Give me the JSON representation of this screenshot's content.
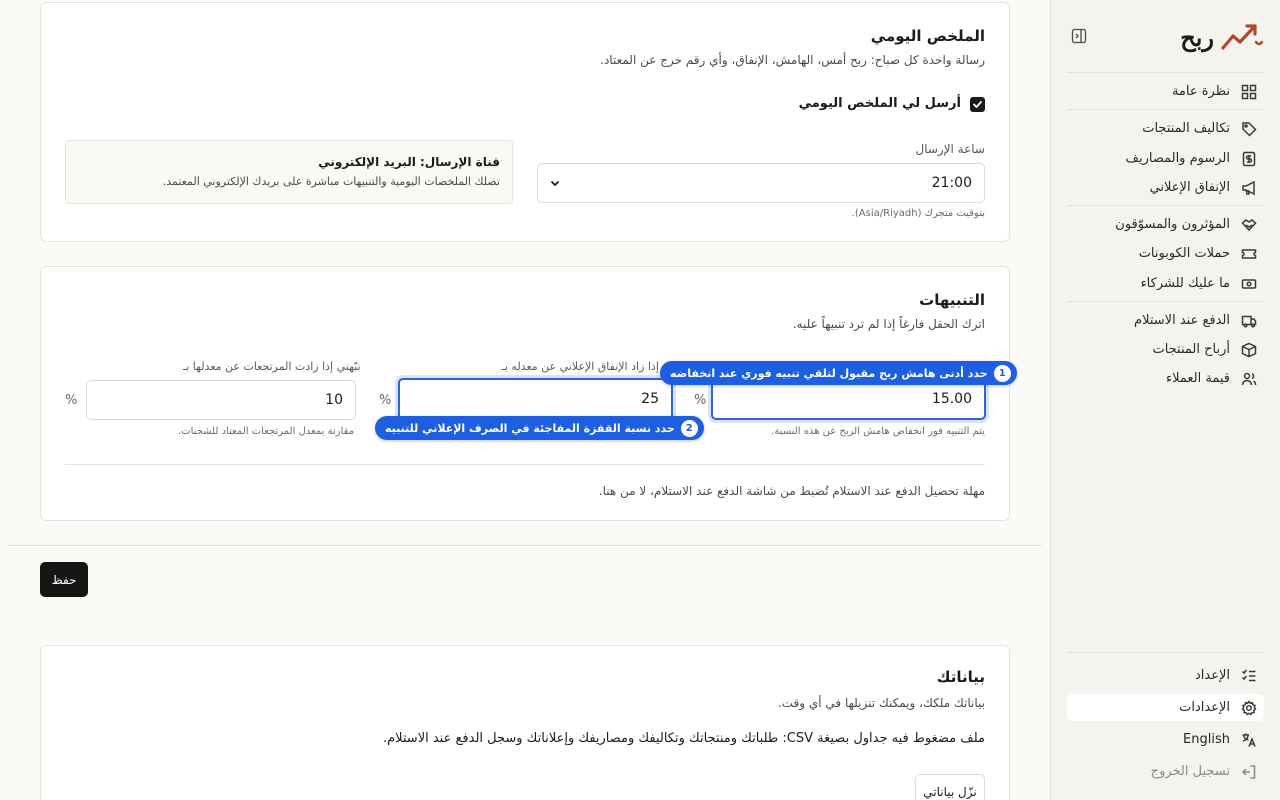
{
  "sidebar": {
    "brand": "ربح",
    "items": [
      {
        "label": "نظرة عامة",
        "icon": "grid-icon"
      },
      {
        "label": "تكاليف المنتجات",
        "icon": "tag-icon"
      },
      {
        "label": "الرسوم والمصاريف",
        "icon": "dollar-receipt-icon"
      },
      {
        "label": "الإنفاق الإعلاني",
        "icon": "megaphone-icon"
      },
      {
        "label": "المؤثرون والمسوّقون",
        "icon": "handshake-icon"
      },
      {
        "label": "حملات الكوبونات",
        "icon": "ticket-icon"
      },
      {
        "label": "ما عليك للشركاء",
        "icon": "banknote-icon"
      },
      {
        "label": "الدفع عند الاستلام",
        "icon": "truck-icon"
      },
      {
        "label": "أرباح المنتجات",
        "icon": "box-icon"
      },
      {
        "label": "قيمة العملاء",
        "icon": "users-icon"
      }
    ],
    "bottom": [
      {
        "label": "الإعداد",
        "icon": "checklist-icon"
      },
      {
        "label": "الإعدادات",
        "icon": "gear-icon"
      },
      {
        "label": "English",
        "icon": "translate-icon"
      },
      {
        "label": "تسجيل الخروج",
        "icon": "logout-icon"
      }
    ]
  },
  "daily_summary": {
    "title": "الملخص اليومي",
    "description": "رسالة واحدة كل صباح: ربح أمس، الهامش، الإنفاق، وأي رقم خرج عن المعتاد.",
    "checkbox_label": "أرسل لي الملخص اليومي",
    "checkbox_checked": true,
    "send_time_label": "ساعة الإرسال",
    "send_time_value": "21:00",
    "timezone_hint": "بتوقيت متجرك (Asia/Riyadh).",
    "channel_title": "قناة الإرسال: البريد الإلكتروني",
    "channel_desc": "تصلك الملخصات اليومية والتنبيهات مباشرة على بريدك الإلكتروني المعتمد."
  },
  "alerts": {
    "title": "التنبيهات",
    "description": "اترك الحقل فارغاً إذا لم ترد تنبيهاً عليه.",
    "fields": [
      {
        "label": "",
        "value": "15.00",
        "unit": "%",
        "hint": "يتم التنبيه فور انخفاض هامش الربح عن هذه النسبة."
      },
      {
        "label": "ي إذا زاد الإنفاق الإعلاني عن معدله بـ",
        "value": "25",
        "unit": "%",
        "hint": ""
      },
      {
        "label": "نبّهني إذا زادت المرتجعات عن معدلها بـ",
        "value": "10",
        "unit": "%",
        "hint": "مقارنة بمعدل المرتجعات المعتاد للشحنات."
      }
    ],
    "callout_1": {
      "num": "1",
      "text": "حدد أدنى هامش ربح مقبول لتلقي تنبيه فوري عند انخفاضه"
    },
    "callout_2": {
      "num": "2",
      "text": "حدد نسبة القفزة المفاجئة في الصرف الإعلاني للتنبيه"
    },
    "cod_note": "مهلة تحصيل الدفع عند الاستلام تُضبط من شاشة الدفع عند الاستلام، لا من هنا."
  },
  "save_button": "حفظ",
  "your_data": {
    "title": "بياناتك",
    "description": "بياناتك ملكك، ويمكنك تنزيلها في أي وقت.",
    "detail": "ملف مضغوط فيه جداول بصيغة CSV: طلباتك ومنتجاتك وتكاليفك ومصاريفك وإعلاناتك وسجل الدفع عند الاستلام.",
    "download_button": "نزّل بياناتي"
  },
  "colors": {
    "accent": "#1d5fe0",
    "brand": "#b5452a",
    "dark": "#161513"
  }
}
